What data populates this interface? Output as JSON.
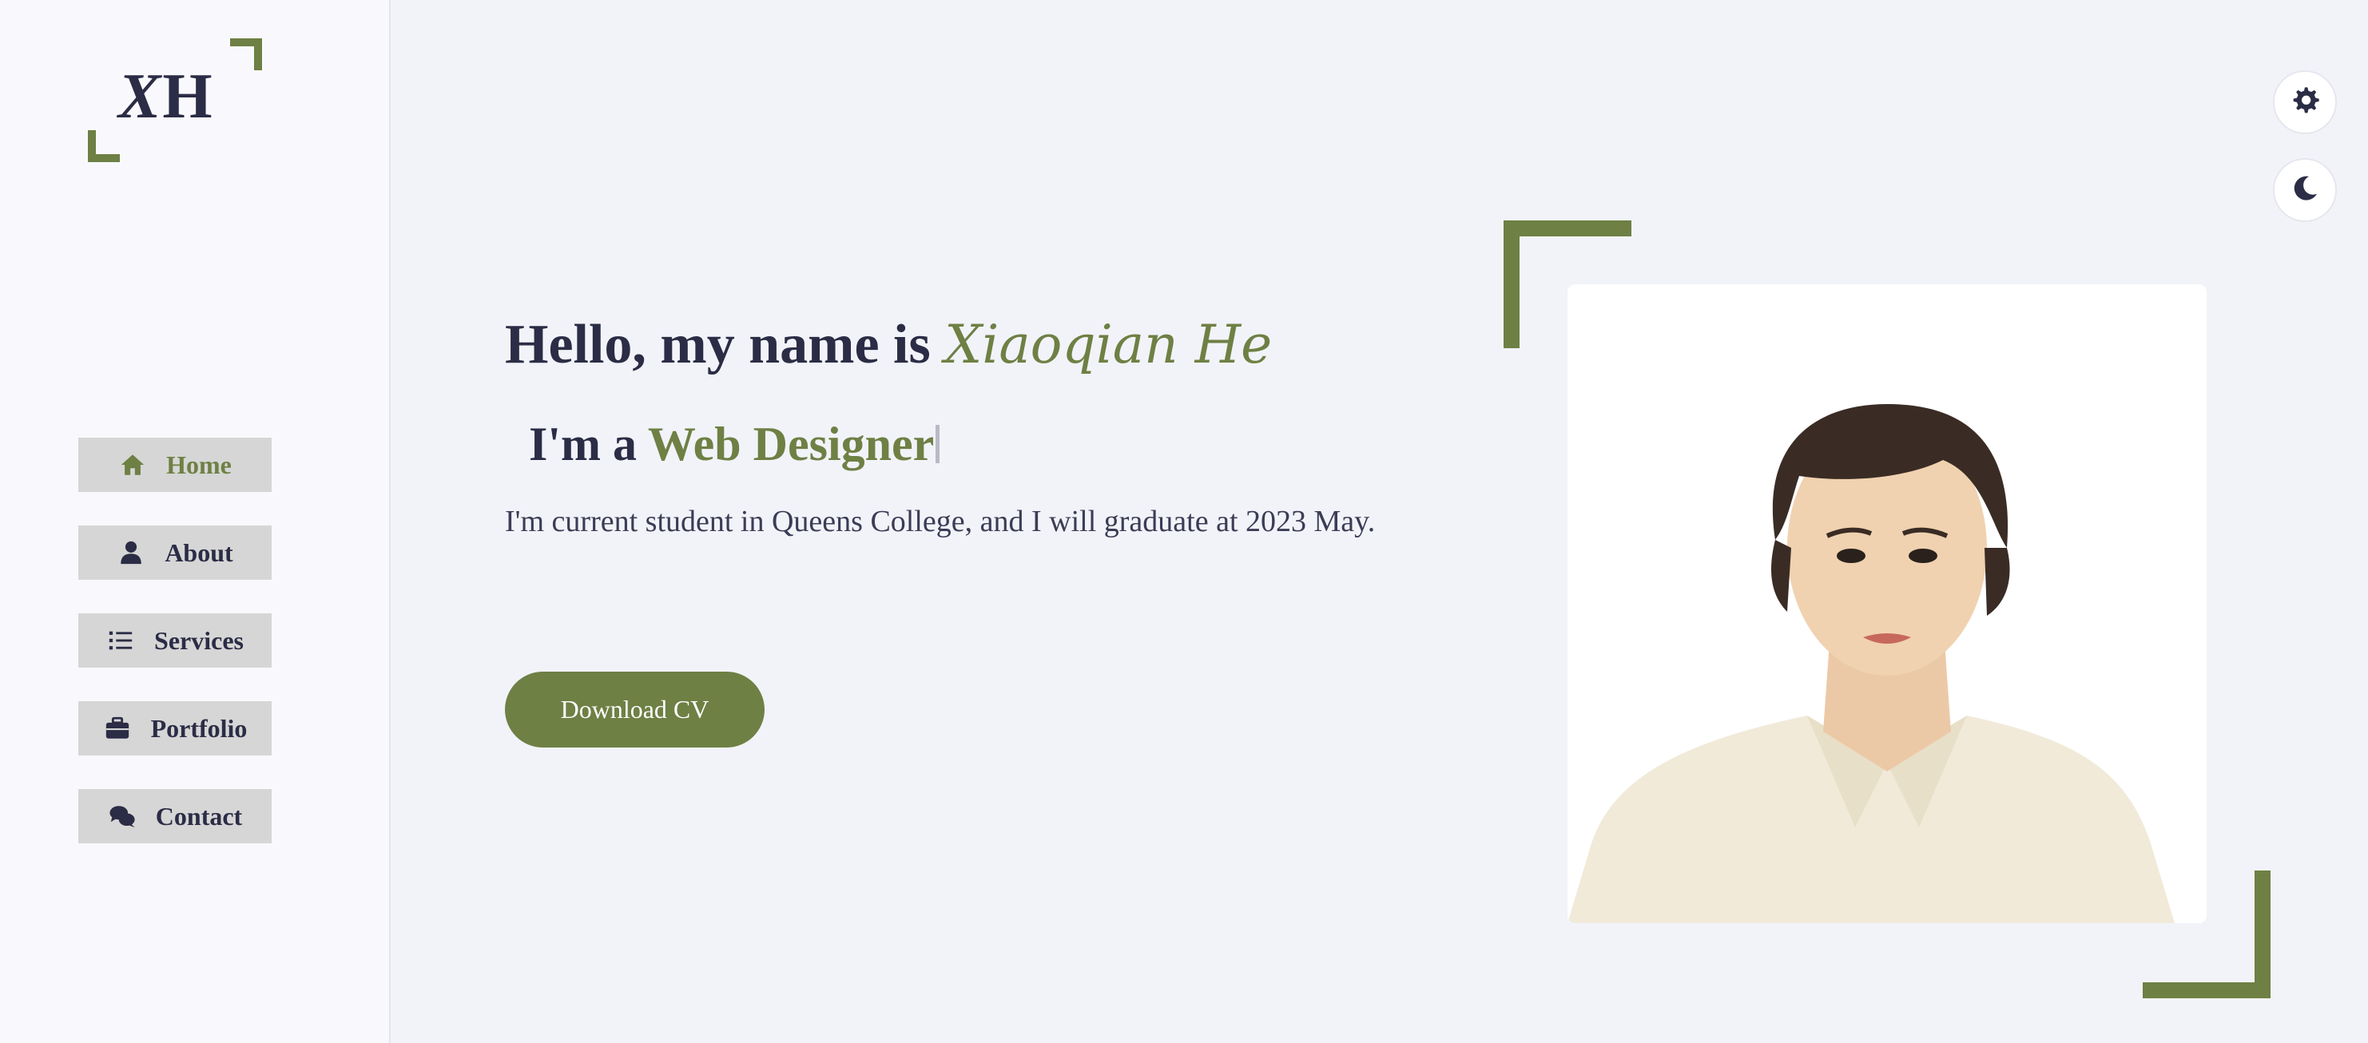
{
  "logo": {
    "text_x": "X",
    "text_h": "H"
  },
  "nav": {
    "items": [
      {
        "label": "Home",
        "icon": "home-icon",
        "active": true
      },
      {
        "label": "About",
        "icon": "user-icon",
        "active": false
      },
      {
        "label": "Services",
        "icon": "list-icon",
        "active": false
      },
      {
        "label": "Portfolio",
        "icon": "briefcase-icon",
        "active": false
      },
      {
        "label": "Contact",
        "icon": "comments-icon",
        "active": false
      }
    ]
  },
  "hero": {
    "greeting_prefix": "Hello, my name is ",
    "name": "Xiaoqian He",
    "role_prefix": "I'm a ",
    "role_highlight": "Web Designer",
    "description": "I'm current student in Queens College, and I will graduate at 2023 May.",
    "cv_button": "Download CV"
  },
  "controls": {
    "settings_icon": "gear-icon",
    "theme_icon": "moon-icon"
  },
  "colors": {
    "accent": "#6e8044",
    "text": "#2b2c45",
    "background": "#f2f3f9",
    "sidebar": "#f9f9fd",
    "nav_item_bg": "#d6d6d6"
  }
}
